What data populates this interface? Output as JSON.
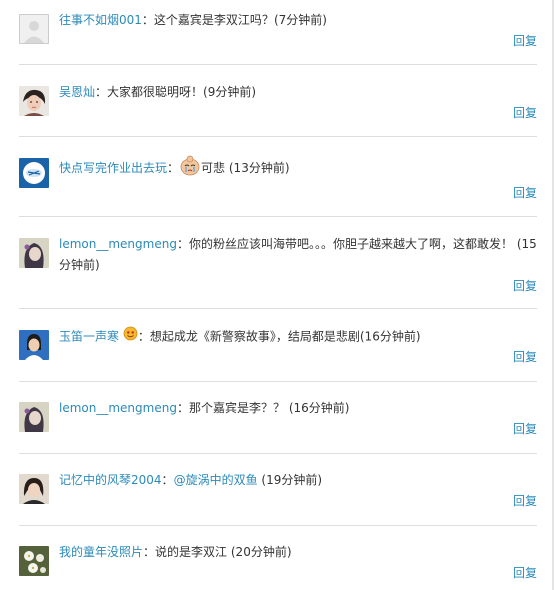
{
  "reply_label": "回复",
  "comments": [
    {
      "user": "往事不如烟001",
      "sep": "：",
      "text": "这个嘉宾是李双江吗？",
      "time": "(7分钟前)"
    },
    {
      "user": "吴恩灿",
      "sep": "：",
      "text": "大家都很聪明呀！",
      "time": "(9分钟前)"
    },
    {
      "user": "快点写完作业出去玩",
      "sep": "：",
      "text": "可悲",
      "time": "(13分钟前)"
    },
    {
      "user": "lemon__mengmeng",
      "sep": "：",
      "text": "你的粉丝应该叫海带吧。。。你胆子越来越大了啊，这都敢发！",
      "time": "(15分钟前)"
    },
    {
      "user": "玉笛一声寒",
      "sep": "：",
      "text": "想起成龙《新警察故事》，结局都是悲剧",
      "time": "(16分钟前)"
    },
    {
      "user": "lemon__mengmeng",
      "sep": "：",
      "text": "那个嘉宾是李？？",
      "time": "(16分钟前)"
    },
    {
      "user": "记忆中的风琴2004",
      "sep": "：",
      "mention": "@旋涡中的双鱼",
      "time": "(19分钟前)"
    },
    {
      "user": "我的童年没照片",
      "sep": "：",
      "text": "说的是李双江",
      "time": "(20分钟前)"
    }
  ]
}
